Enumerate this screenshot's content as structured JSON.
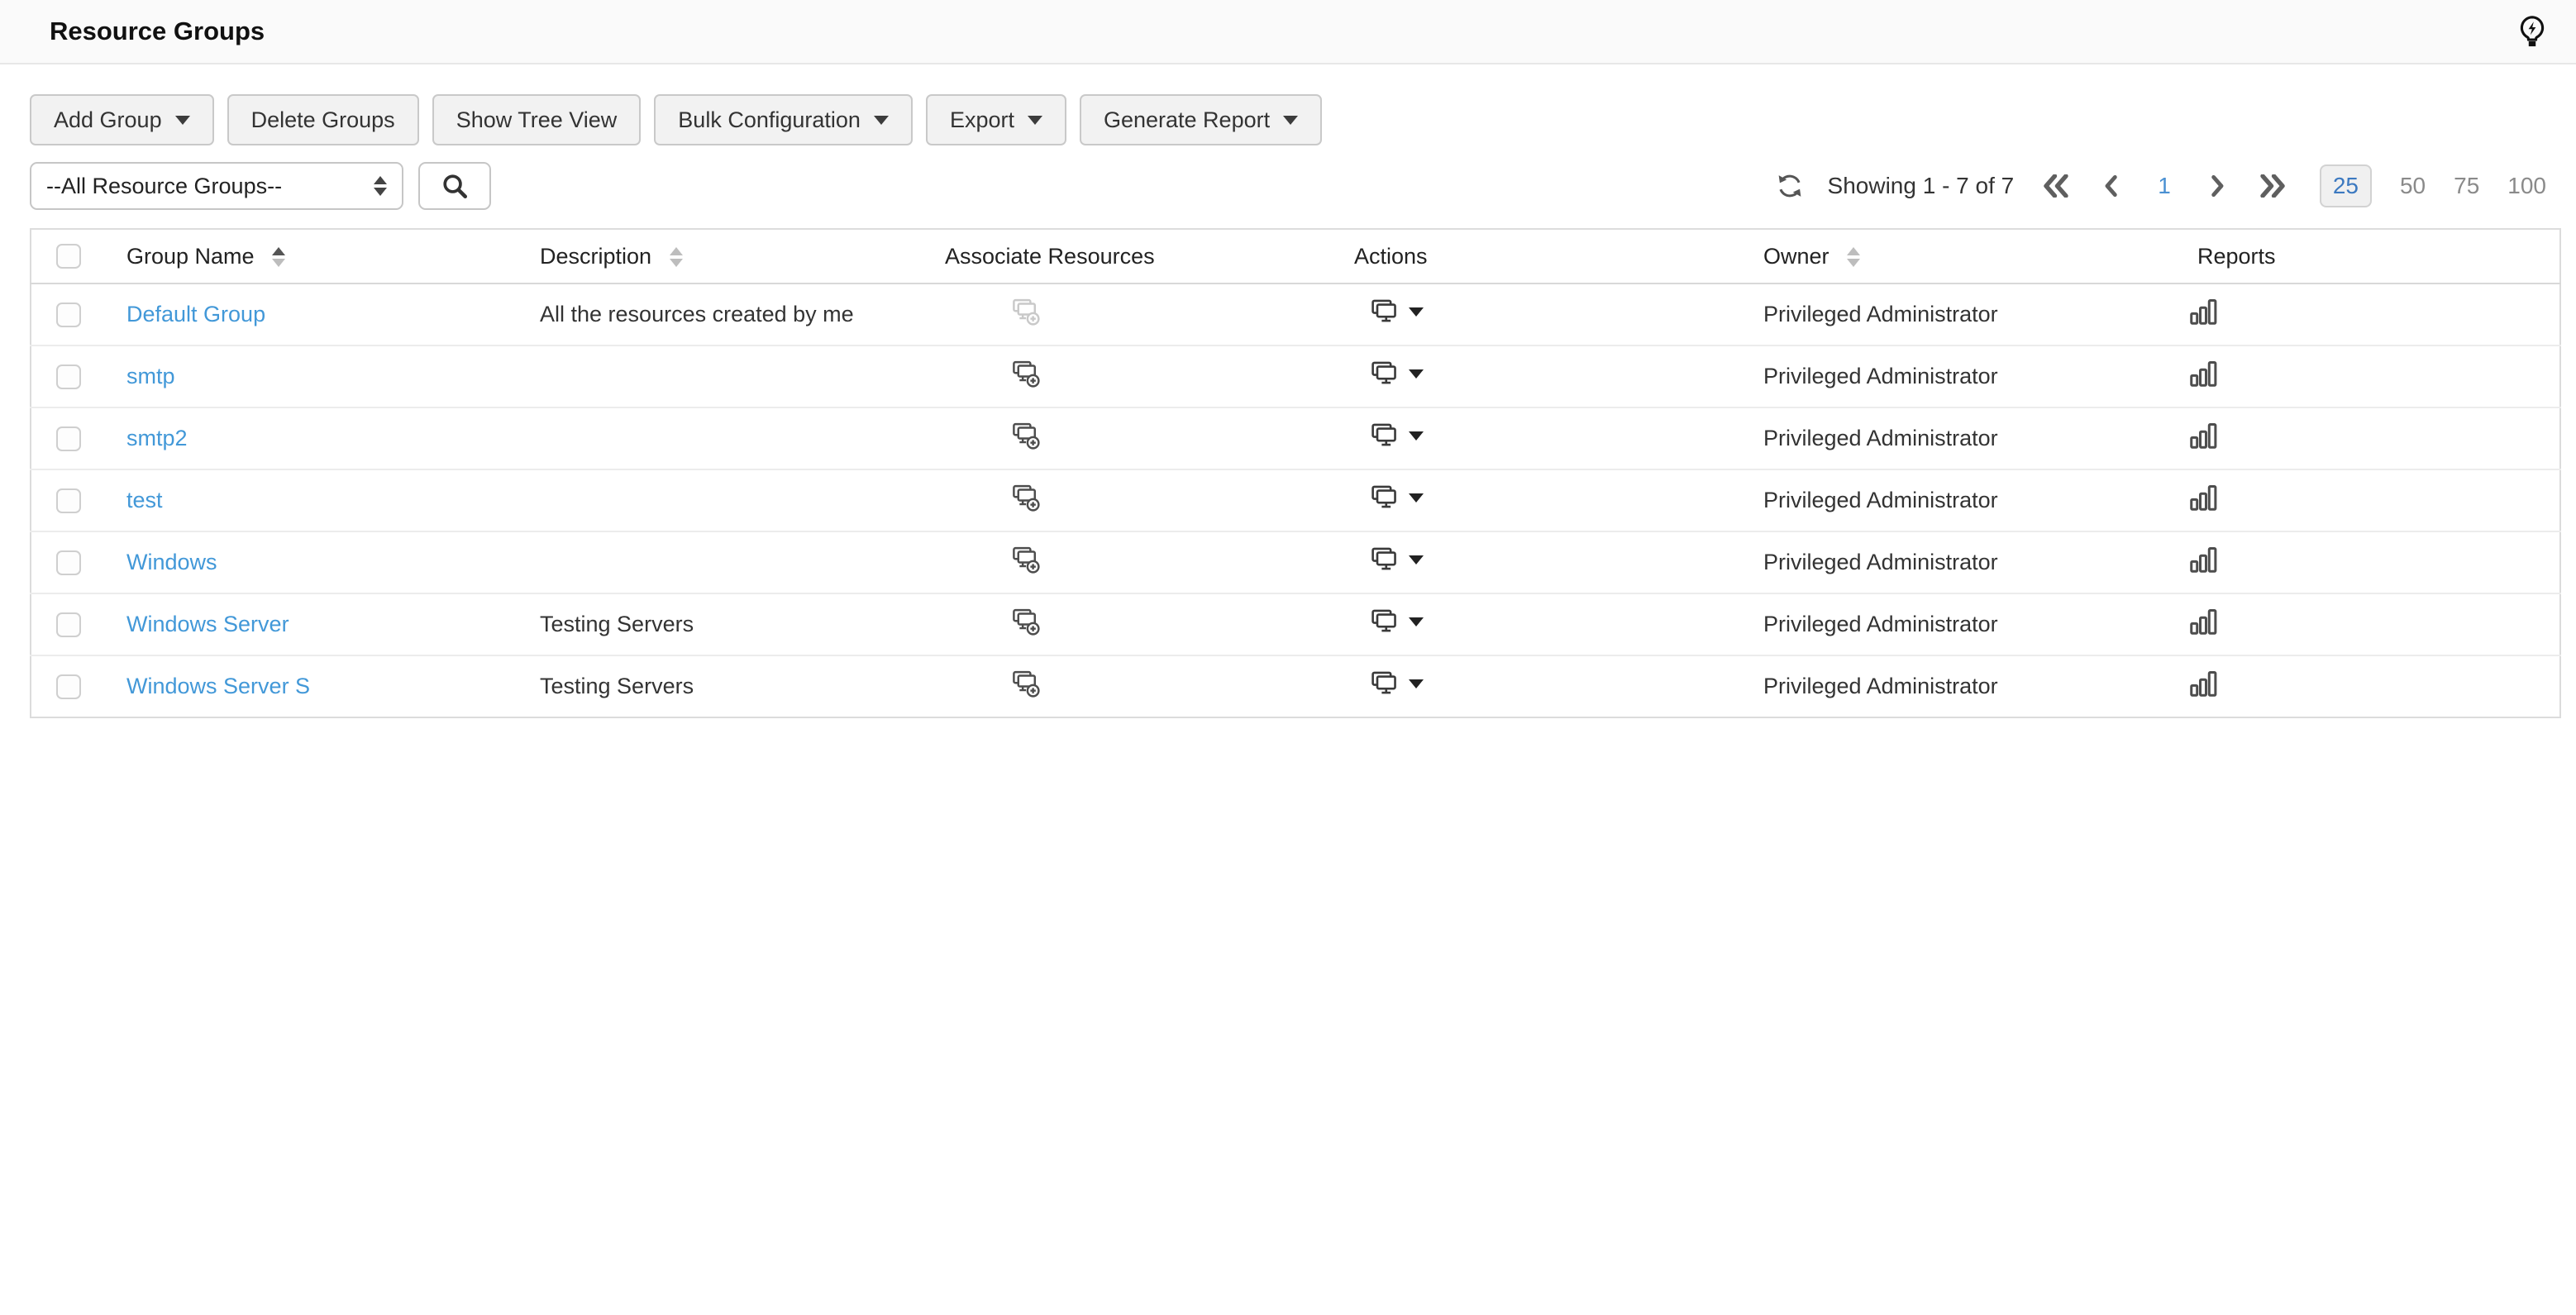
{
  "header": {
    "title": "Resource Groups",
    "help_icon": "lightbulb-bolt-icon"
  },
  "toolbar": {
    "buttons": [
      {
        "label": "Add Group",
        "caret": true
      },
      {
        "label": "Delete Groups",
        "caret": false
      },
      {
        "label": "Show Tree View",
        "caret": false
      },
      {
        "label": "Bulk Configuration",
        "caret": true
      },
      {
        "label": "Export",
        "caret": true
      },
      {
        "label": "Generate Report",
        "caret": true
      }
    ]
  },
  "filter": {
    "group_select_value": "--All Resource Groups--",
    "search_icon": "magnifier-icon"
  },
  "pagination": {
    "refresh_icon": "refresh-icon",
    "showing_text": "Showing 1 - 7 of 7",
    "current_page": "1",
    "page_sizes": [
      "25",
      "50",
      "75",
      "100"
    ],
    "selected_page_size": "25"
  },
  "table": {
    "columns": [
      {
        "label": "Group Name",
        "sortable": true,
        "sorted": "asc"
      },
      {
        "label": "Description",
        "sortable": true,
        "sorted": "none"
      },
      {
        "label": "Associate Resources",
        "sortable": false
      },
      {
        "label": "Actions",
        "sortable": false
      },
      {
        "label": "Owner",
        "sortable": true,
        "sorted": "none"
      },
      {
        "label": "Reports",
        "sortable": false
      }
    ],
    "rows": [
      {
        "name": "Default Group",
        "description": "All the resources created by me",
        "owner": "Privileged Administrator",
        "associate_enabled": false
      },
      {
        "name": "smtp",
        "description": "",
        "owner": "Privileged Administrator",
        "associate_enabled": true
      },
      {
        "name": "smtp2",
        "description": "",
        "owner": "Privileged Administrator",
        "associate_enabled": true
      },
      {
        "name": "test",
        "description": "",
        "owner": "Privileged Administrator",
        "associate_enabled": true
      },
      {
        "name": "Windows",
        "description": "",
        "owner": "Privileged Administrator",
        "associate_enabled": true
      },
      {
        "name": "Windows Server",
        "description": "Testing Servers",
        "owner": "Privileged Administrator",
        "associate_enabled": true
      },
      {
        "name": "Windows Server S",
        "description": "Testing Servers",
        "owner": "Privileged Administrator",
        "associate_enabled": true
      }
    ]
  },
  "colors": {
    "link_blue": "#4298d8",
    "accent_blue": "#3c79c0",
    "button_bg": "#f2f2f2",
    "band_bg": "#fafafa"
  }
}
